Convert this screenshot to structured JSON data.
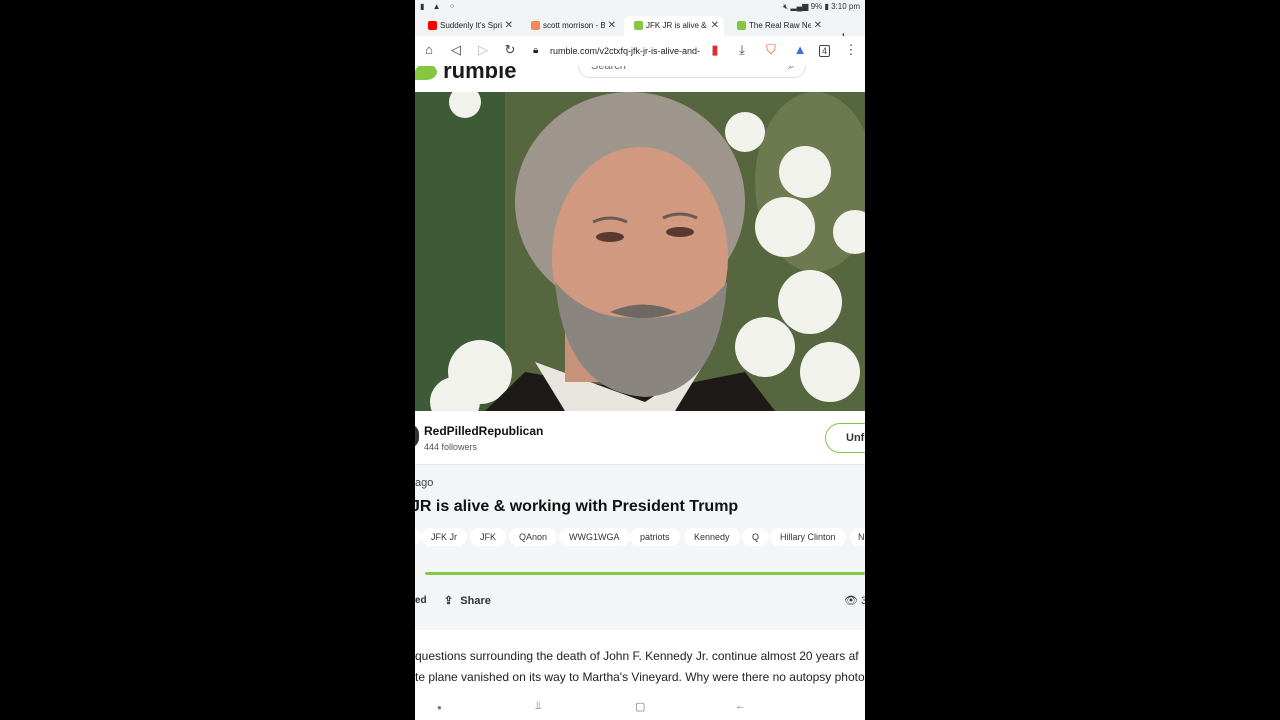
{
  "status_bar": {
    "left_icons": "▮ ▲ ⁘",
    "battery": "9%",
    "time": "3:10 pm"
  },
  "tabs": [
    {
      "label": "Suddenly It's Spring",
      "favicon_color": "#ff0000",
      "active": false
    },
    {
      "label": "scott morrison - Br",
      "favicon_color": "#f08a5d",
      "active": false
    },
    {
      "label": "JFK JR is alive & w",
      "favicon_color": "#85c742",
      "active": true
    },
    {
      "label": "The Real Raw News",
      "favicon_color": "#85c742",
      "active": false
    }
  ],
  "toolbar": {
    "url": "rumble.com/v2ctxfq-jfk-jr-is-alive-and-",
    "tab_count": "4"
  },
  "rumble": {
    "logo_text": "rumble",
    "search_placeholder": "Search"
  },
  "channel": {
    "name": "RedPilledRepublican",
    "followers": "444 followers",
    "follow_label": "Unfo"
  },
  "video_info": {
    "ago": "ago",
    "title": "JR is alive & working with President Trump",
    "tags": [
      "JFK Jr",
      "JFK",
      "QAnon",
      "WWG1WGA",
      "patriots",
      "Kennedy",
      "Q",
      "Hillary Clinton",
      "N"
    ],
    "progress_fraction": 1.0,
    "ed_label": "ed",
    "share_label": "Share",
    "views": "3"
  },
  "description": {
    "line1": "questions surrounding the death of John F. Kennedy Jr. continue almost 20 years af",
    "line2": "te plane vanished on its way to Martha's Vineyard. Why were there no autopsy photo"
  },
  "colors": {
    "accent": "#85c742",
    "tab_bar": "#f1f3f4",
    "info_bg": "#f4f5f7"
  }
}
